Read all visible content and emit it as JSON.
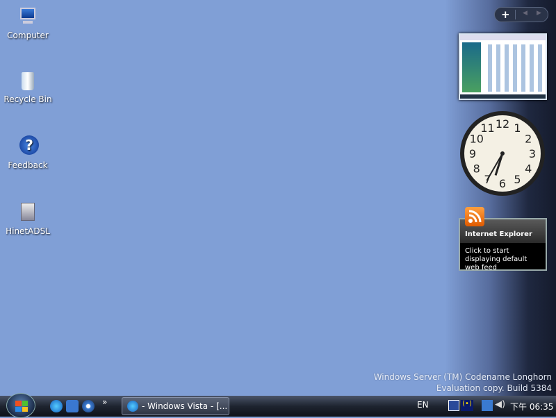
{
  "desktop_icons": [
    {
      "label": "Computer",
      "icon": "computer-icon"
    },
    {
      "label": "Recycle Bin",
      "icon": "recycle-bin-icon"
    },
    {
      "label": "Feedback",
      "icon": "help-icon"
    },
    {
      "label": "HinetADSL",
      "icon": "network-connection-icon"
    }
  ],
  "watermark": {
    "line1": "Windows Server (TM) Codename Longhorn",
    "line2": "Evaluation copy. Build 5384"
  },
  "sidebar": {
    "add_label": "+",
    "prev_label": "◀",
    "next_label": "▶",
    "rss": {
      "title": "Internet Explorer",
      "message": "Click to start displaying default web feed"
    },
    "clock_numbers": [
      "12",
      "1",
      "2",
      "3",
      "4",
      "5",
      "6",
      "7",
      "8",
      "9",
      "10",
      "11"
    ],
    "clock_time": {
      "hour": 6,
      "minute": 35
    }
  },
  "taskbar": {
    "overflow_label": "»",
    "window_button": "- Windows Vista - [...",
    "language": "EN",
    "clock": "下午 06:35"
  },
  "colors": {
    "desktop": "#809fd6",
    "taskbar": "#1e2430"
  }
}
